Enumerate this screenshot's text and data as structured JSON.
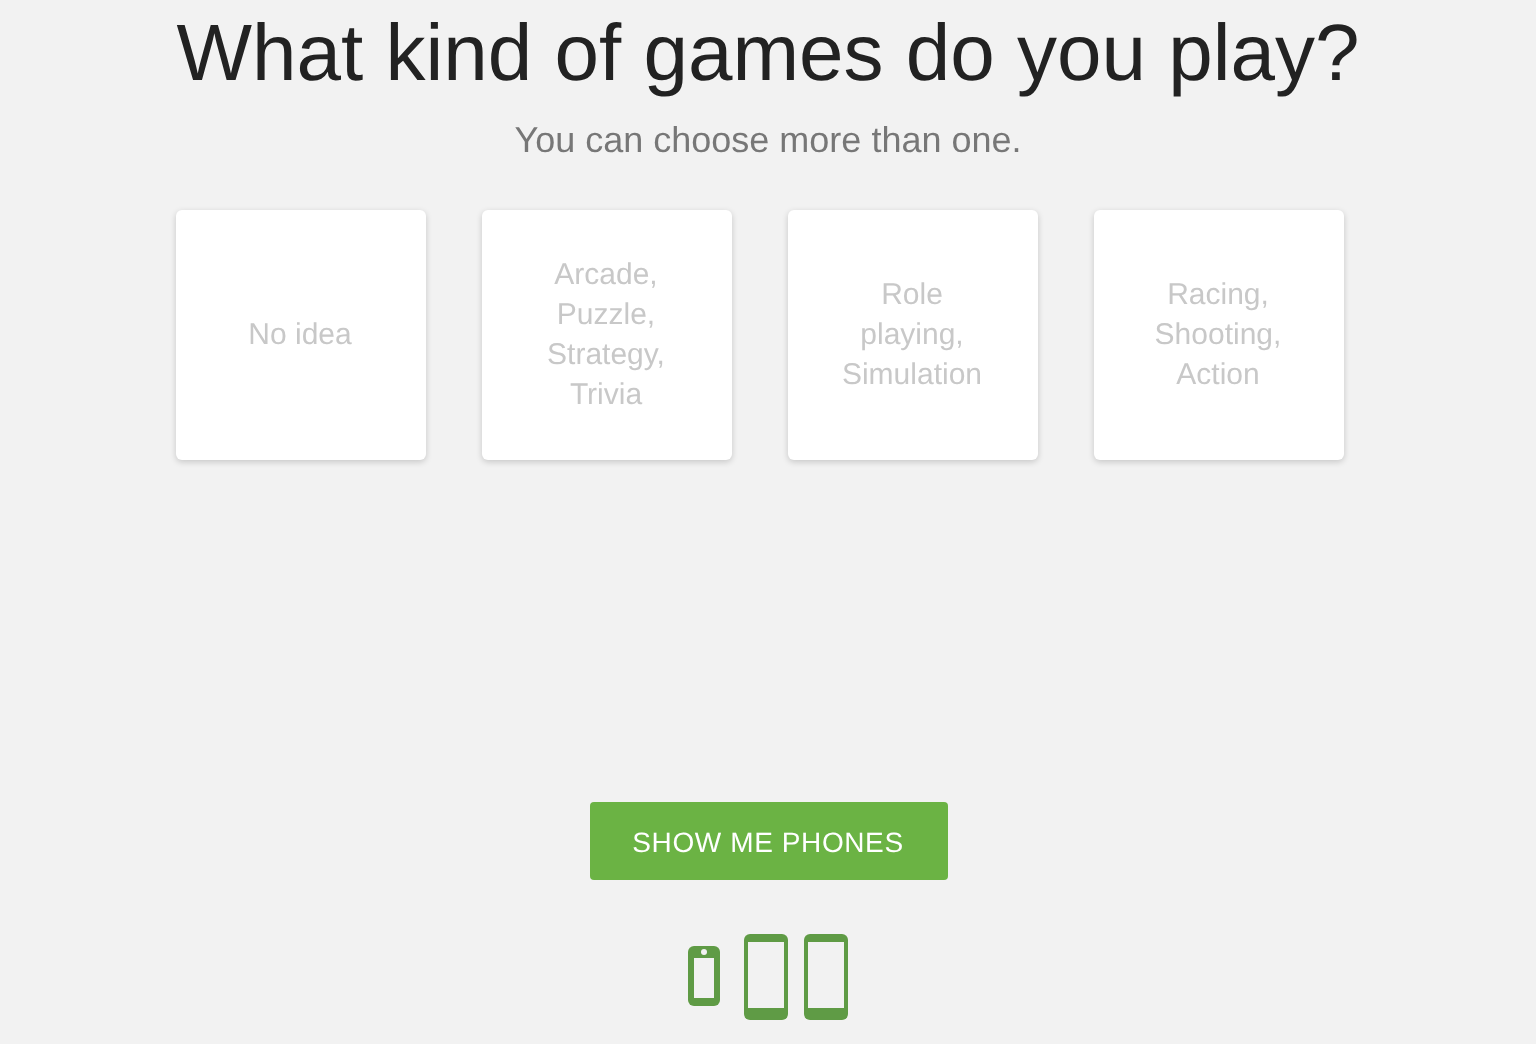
{
  "title": "What kind of games do you play?",
  "subtitle": "You can choose more than one.",
  "options": [
    {
      "label": "No idea",
      "selected": false
    },
    {
      "label": "Arcade, Puzzle, Strategy, Trivia",
      "selected": false
    },
    {
      "label": "Role playing, Simulation",
      "selected": false
    },
    {
      "label": "Racing, Shooting, Action",
      "selected": false
    }
  ],
  "button": "SHOW ME PHONES"
}
